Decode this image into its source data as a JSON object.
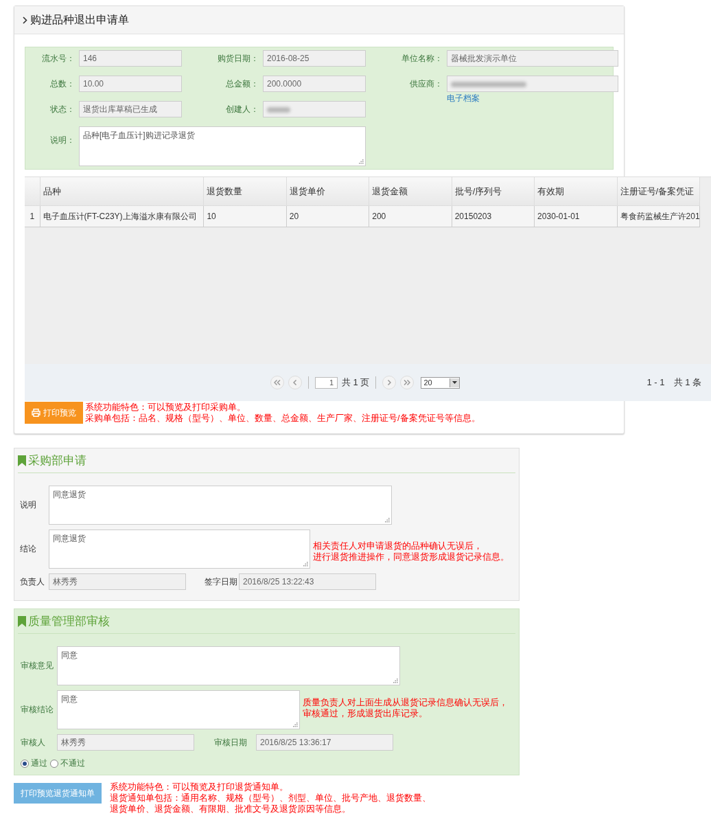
{
  "panel": {
    "title": "购进品种退出申请单"
  },
  "form": {
    "fields": [
      {
        "label": "流水号：",
        "value": "146"
      },
      {
        "label": "购货日期：",
        "value": "2016-08-25"
      },
      {
        "label": "单位名称：",
        "value": "器械批发演示单位"
      },
      {
        "label": "总数：",
        "value": "10.00"
      },
      {
        "label": "总金额：",
        "value": "200.0000"
      },
      {
        "label": "供应商：",
        "kind": "blurred",
        "link": "电子档案"
      },
      {
        "label": "状态：",
        "value": "退货出库草稿已生成"
      },
      {
        "label": "创建人：",
        "kind": "blurred"
      }
    ],
    "remark": {
      "label": "说明：",
      "value": "品种[电子血压计]购进记录退货"
    }
  },
  "table": {
    "columns": [
      "品种",
      "退货数量",
      "退货单价",
      "退货金额",
      "批号/序列号",
      "有效期",
      "注册证号/备案凭证"
    ],
    "rows": [
      {
        "index": "1",
        "cells": [
          "电子血压计(FT-C23Y)上海溢水康有限公司",
          "10",
          "20",
          "200",
          "20150203",
          "2030-01-01",
          "粤食药监械生产许201"
        ]
      }
    ]
  },
  "pager": {
    "page": "1",
    "pages": "共 1 页",
    "page_size": "20",
    "summary": "1 - 1　共 1 条"
  },
  "print": {
    "button": "打印预览",
    "notes": [
      "系统功能特色：可以预览及打印采购单。",
      "采购单包括：品名、规格（型号）、单位、数量、总金额、生产厂家、注册证号/备案凭证号等信息。"
    ]
  },
  "sections": [
    {
      "kind": "gray",
      "title": "采购部申请",
      "areas": [
        {
          "label": "说明",
          "value": "同意退货"
        },
        {
          "label": "结论",
          "value": "同意退货"
        }
      ],
      "notes": [
        "相关责任人对申请退货的品种确认无误后，",
        "进行退货推进操作，同意退货形成退货记录信息。"
      ],
      "people": [
        {
          "label": "负责人",
          "value": "林秀秀"
        },
        {
          "label": "签字日期",
          "value": "2016/8/25 13:22:43"
        }
      ]
    },
    {
      "kind": "green",
      "title": "质量管理部审核",
      "areas": [
        {
          "label": "审核意见",
          "value": "同意"
        },
        {
          "label": "审核结论",
          "value": "同意"
        }
      ],
      "notes": [
        "质量负责人对上面生成从退货记录信息确认无误后，",
        "审核通过，形成退货出库记录。"
      ],
      "people": [
        {
          "label": "审核人",
          "value": "林秀秀"
        },
        {
          "label": "审核日期",
          "value": "2016/8/25 13:36:17"
        }
      ],
      "radios": [
        {
          "label": "通过",
          "selected": true
        },
        {
          "label": "不通过",
          "selected": false
        }
      ]
    }
  ],
  "bottom": {
    "button": "打印预览退货通知单",
    "notes": [
      "系统功能特色：可以预览及打印退货通知单。",
      "退货通知单包括：通用名称、规格（型号）、剂型、单位、批号产地、退货数量、",
      "退货单价、退货金额、有限期、批准文号及退货原因等信息。"
    ]
  }
}
